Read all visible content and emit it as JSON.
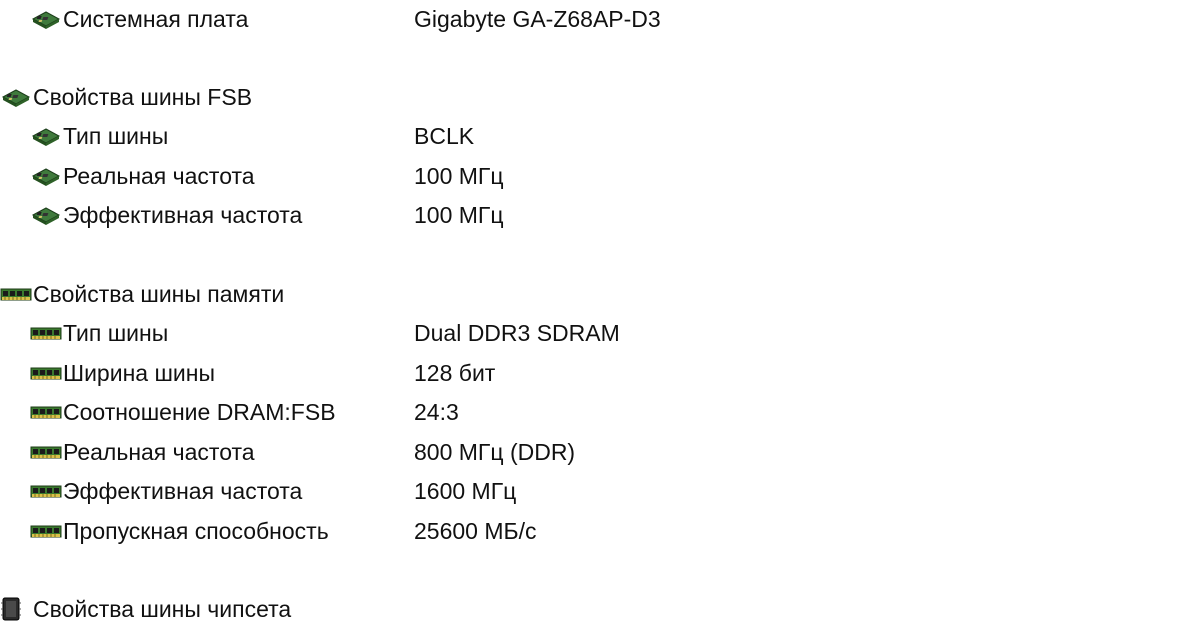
{
  "rows": [
    {
      "icon": "motherboard-icon",
      "label": "Системная плата",
      "value": "Gigabyte GA-Z68AP-D3"
    },
    {
      "icon": "motherboard-icon",
      "label": "Свойства шины FSB"
    },
    {
      "icon": "motherboard-icon",
      "label": "Тип шины",
      "value": "BCLK"
    },
    {
      "icon": "motherboard-icon",
      "label": "Реальная частота",
      "value": "100 МГц"
    },
    {
      "icon": "motherboard-icon",
      "label": "Эффективная частота",
      "value": "100 МГц"
    },
    {
      "icon": "memory-module-icon",
      "label": "Свойства шины памяти"
    },
    {
      "icon": "memory-module-icon",
      "label": "Тип шины",
      "value": "Dual DDR3 SDRAM"
    },
    {
      "icon": "memory-module-icon",
      "label": "Ширина шины",
      "value": "128 бит"
    },
    {
      "icon": "memory-module-icon",
      "label": "Соотношение DRAM:FSB",
      "value": "24:3"
    },
    {
      "icon": "memory-module-icon",
      "label": "Реальная частота",
      "value": "800 МГц (DDR)"
    },
    {
      "icon": "memory-module-icon",
      "label": "Эффективная частота",
      "value": "1600 МГц"
    },
    {
      "icon": "memory-module-icon",
      "label": "Пропускная способность",
      "value": "25600 МБ/с"
    },
    {
      "icon": "chipset-icon",
      "label": "Свойства шины чипсета"
    }
  ]
}
